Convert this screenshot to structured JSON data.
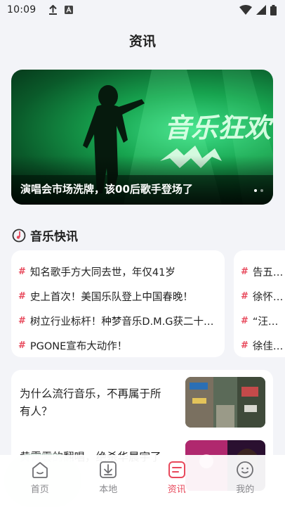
{
  "status_bar": {
    "time": "10:09"
  },
  "header": {
    "title": "资讯"
  },
  "banner": {
    "caption": "演唱会市场洗牌，该00后歌手登场了",
    "art_text": "音乐狂欢"
  },
  "music_flash": {
    "title": "音乐快讯",
    "cards": [
      {
        "items": [
          "知名歌手方大同去世，年仅41岁",
          "史上首次！美国乐队登上中国春晚！",
          "树立行业标杆！种梦音乐D.M.G获二十…",
          "PGONE宣布大动作！"
        ]
      },
      {
        "items": [
          "告五人…",
          "徐怀钰…",
          "“汪峰…",
          "徐佳莹…"
        ]
      }
    ]
  },
  "articles": [
    {
      "title": "为什么流行音乐，不再属于所有人？",
      "thumb_icon": "street-photo"
    },
    {
      "title": "黄霄雲的翻唱，绝杀华晨宇了",
      "thumb_icon": "stage-photo"
    }
  ],
  "tabbar": {
    "tabs": [
      {
        "label": "首页",
        "icon": "home-icon"
      },
      {
        "label": "本地",
        "icon": "download-icon"
      },
      {
        "label": "资讯",
        "icon": "news-icon",
        "active": true
      },
      {
        "label": "我的",
        "icon": "profile-icon"
      }
    ]
  },
  "colors": {
    "accent": "#e8495c",
    "background": "#f3f4f8"
  }
}
